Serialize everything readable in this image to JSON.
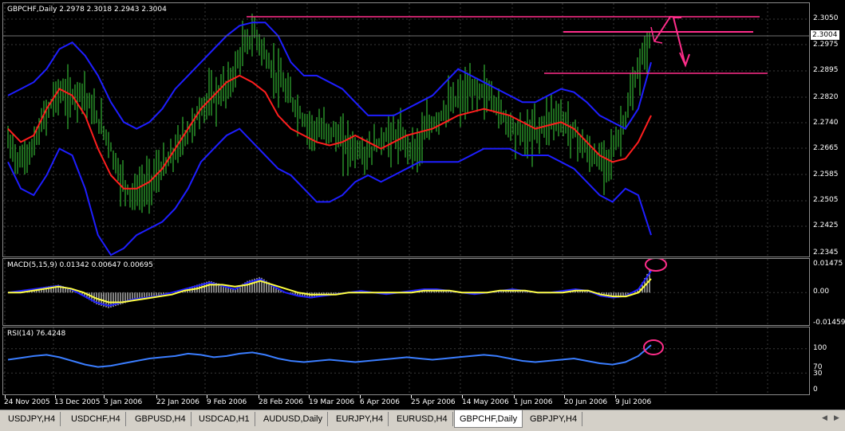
{
  "main_panel": {
    "label": "GBPCHF,Daily  2.2978 2.3018 2.2943 2.3004",
    "current_price": "2.3004",
    "price_min": 2.2345,
    "price_max": 2.305,
    "price_labels": [
      "2.3050",
      "2.2975",
      "2.2895",
      "2.2820",
      "2.2740",
      "2.2665",
      "2.2585",
      "2.2505",
      "2.2425",
      "2.2345"
    ],
    "colors": {
      "candles": "#3bd63b",
      "upper_band": "#1e1eff",
      "lower_band": "#1e1eff",
      "middle_ma": "#ff1e1e",
      "annotation": "#ff2d8a"
    }
  },
  "macd_panel": {
    "label": "MACD(5,15,9) 0.01342 0.00647 0.00695",
    "axis_labels": [
      "0.01475",
      "0.00",
      "-0.01459"
    ],
    "min": -0.01459,
    "max": 0.01475,
    "colors": {
      "histogram": "#ffffff",
      "signal": "#ffff40",
      "macd": "#1e1eff"
    }
  },
  "rsi_panel": {
    "label": "RSI(14) 76.4248",
    "axis_labels": [
      "100",
      "70",
      "30",
      "0"
    ],
    "min": 0,
    "max": 100,
    "colors": {
      "rsi": "#3a7dff"
    }
  },
  "time_axis": {
    "labels": [
      "24 Nov 2005",
      "13 Dec 2005",
      "3 Jan 2006",
      "22 Jan 2006",
      "9 Feb 2006",
      "28 Feb 2006",
      "19 Mar 2006",
      "6 Apr 2006",
      "25 Apr 2006",
      "14 May 2006",
      "1 Jun 2006",
      "20 Jun 2006",
      "9 Jul 2006"
    ]
  },
  "tabs": [
    {
      "label": "USDJPY,H4",
      "active": false
    },
    {
      "label": "USDCHF,H4",
      "active": false
    },
    {
      "label": "GBPUSD,H4",
      "active": false
    },
    {
      "label": "USDCAD,H1",
      "active": false
    },
    {
      "label": "AUDUSD,Daily",
      "active": false
    },
    {
      "label": "EURJPY,H4",
      "active": false
    },
    {
      "label": "EURUSD,H4",
      "active": false
    },
    {
      "label": "GBPCHF,Daily",
      "active": true
    },
    {
      "label": "GBPJPY,H4",
      "active": false
    }
  ],
  "chart_data": [
    {
      "type": "line",
      "title": "GBPCHF,Daily",
      "series": [
        {
          "values": [
            2.268,
            2.262,
            2.266,
            2.276,
            2.283,
            2.281,
            2.284,
            2.276,
            2.27,
            2.258,
            2.252,
            2.254,
            2.258,
            2.262,
            2.268,
            2.274,
            2.28,
            2.282,
            2.286,
            2.296,
            2.301,
            2.292,
            2.286,
            2.28,
            2.274,
            2.271,
            2.272,
            2.268,
            2.266,
            2.264,
            2.268,
            2.27,
            2.268,
            2.266,
            2.272,
            2.276,
            2.28,
            2.282,
            2.284,
            2.282,
            2.276,
            2.272,
            2.27,
            2.272,
            2.276,
            2.274,
            2.27,
            2.264,
            2.262,
            2.266,
            2.276,
            2.29,
            2.3
          ]
        },
        {
          "values": [
            2.272,
            2.268,
            2.27,
            2.278,
            2.284,
            2.282,
            2.276,
            2.266,
            2.258,
            2.254,
            2.254,
            2.256,
            2.26,
            2.266,
            2.272,
            2.278,
            2.282,
            2.286,
            2.288,
            2.286,
            2.283,
            2.276,
            2.272,
            2.27,
            2.268,
            2.267,
            2.268,
            2.27,
            2.268,
            2.266,
            2.268,
            2.27,
            2.271,
            2.272,
            2.274,
            2.276,
            2.277,
            2.278,
            2.277,
            2.276,
            2.274,
            2.272,
            2.273,
            2.274,
            2.272,
            2.268,
            2.264,
            2.262,
            2.263,
            2.268,
            2.276
          ]
        },
        {
          "values": [
            2.282,
            2.284,
            2.286,
            2.29,
            2.296,
            2.298,
            2.294,
            2.288,
            2.28,
            2.274,
            2.272,
            2.274,
            2.278,
            2.284,
            2.288,
            2.292,
            2.296,
            2.3,
            2.303,
            2.304,
            2.304,
            2.3,
            2.292,
            2.288,
            2.288,
            2.286,
            2.284,
            2.28,
            2.276,
            2.276,
            2.276,
            2.278,
            2.28,
            2.282,
            2.286,
            2.29,
            2.288,
            2.286,
            2.284,
            2.282,
            2.28,
            2.28,
            2.282,
            2.284,
            2.283,
            2.28,
            2.276,
            2.274,
            2.272,
            2.278,
            2.292
          ]
        },
        {
          "values": [
            2.262,
            2.254,
            2.252,
            2.258,
            2.266,
            2.264,
            2.254,
            2.24,
            2.234,
            2.236,
            2.24,
            2.242,
            2.244,
            2.248,
            2.254,
            2.262,
            2.266,
            2.27,
            2.272,
            2.268,
            2.264,
            2.26,
            2.258,
            2.254,
            2.25,
            2.25,
            2.252,
            2.256,
            2.258,
            2.256,
            2.258,
            2.26,
            2.262,
            2.262,
            2.262,
            2.262,
            2.264,
            2.266,
            2.266,
            2.266,
            2.264,
            2.264,
            2.264,
            2.262,
            2.26,
            2.256,
            2.252,
            2.25,
            2.254,
            2.252,
            2.24
          ]
        }
      ]
    },
    {
      "type": "line",
      "title": "MACD(5,15,9)",
      "series": [
        {
          "values": [
            0.0,
            0.001,
            0.002,
            0.003,
            0.004,
            0.002,
            -0.002,
            -0.006,
            -0.008,
            -0.006,
            -0.004,
            -0.003,
            -0.002,
            0.0,
            0.002,
            0.004,
            0.006,
            0.004,
            0.002,
            0.006,
            0.008,
            0.004,
            0.0,
            -0.002,
            -0.003,
            -0.002,
            -0.001,
            0.0,
            0.001,
            0.0,
            -0.001,
            0.0,
            0.001,
            0.002,
            0.002,
            0.001,
            0.0,
            -0.001,
            0.0,
            0.001,
            0.002,
            0.001,
            0.0,
            0.0,
            0.001,
            0.002,
            0.001,
            -0.002,
            -0.003,
            -0.002,
            0.002,
            0.013
          ]
        },
        {
          "values": [
            0.0,
            0.0,
            0.001,
            0.002,
            0.003,
            0.002,
            0.0,
            -0.003,
            -0.005,
            -0.005,
            -0.004,
            -0.003,
            -0.002,
            -0.001,
            0.001,
            0.002,
            0.004,
            0.004,
            0.003,
            0.004,
            0.006,
            0.004,
            0.002,
            0.0,
            -0.001,
            -0.001,
            -0.001,
            0.0,
            0.0,
            0.0,
            0.0,
            0.0,
            0.0,
            0.001,
            0.001,
            0.001,
            0.0,
            0.0,
            0.0,
            0.001,
            0.001,
            0.001,
            0.0,
            0.0,
            0.0,
            0.001,
            0.001,
            -0.001,
            -0.002,
            -0.002,
            0.0,
            0.007
          ]
        }
      ],
      "ylim": [
        -0.01459,
        0.01475
      ]
    },
    {
      "type": "line",
      "title": "RSI(14)",
      "series": [
        {
          "values": [
            52,
            55,
            58,
            60,
            56,
            50,
            44,
            40,
            42,
            46,
            50,
            54,
            56,
            58,
            62,
            60,
            56,
            58,
            62,
            64,
            60,
            54,
            50,
            48,
            50,
            52,
            50,
            48,
            50,
            52,
            54,
            56,
            54,
            52,
            54,
            56,
            58,
            60,
            58,
            54,
            50,
            48,
            50,
            52,
            54,
            50,
            46,
            44,
            48,
            58,
            76
          ]
        }
      ],
      "ylim": [
        0,
        100
      ]
    }
  ]
}
